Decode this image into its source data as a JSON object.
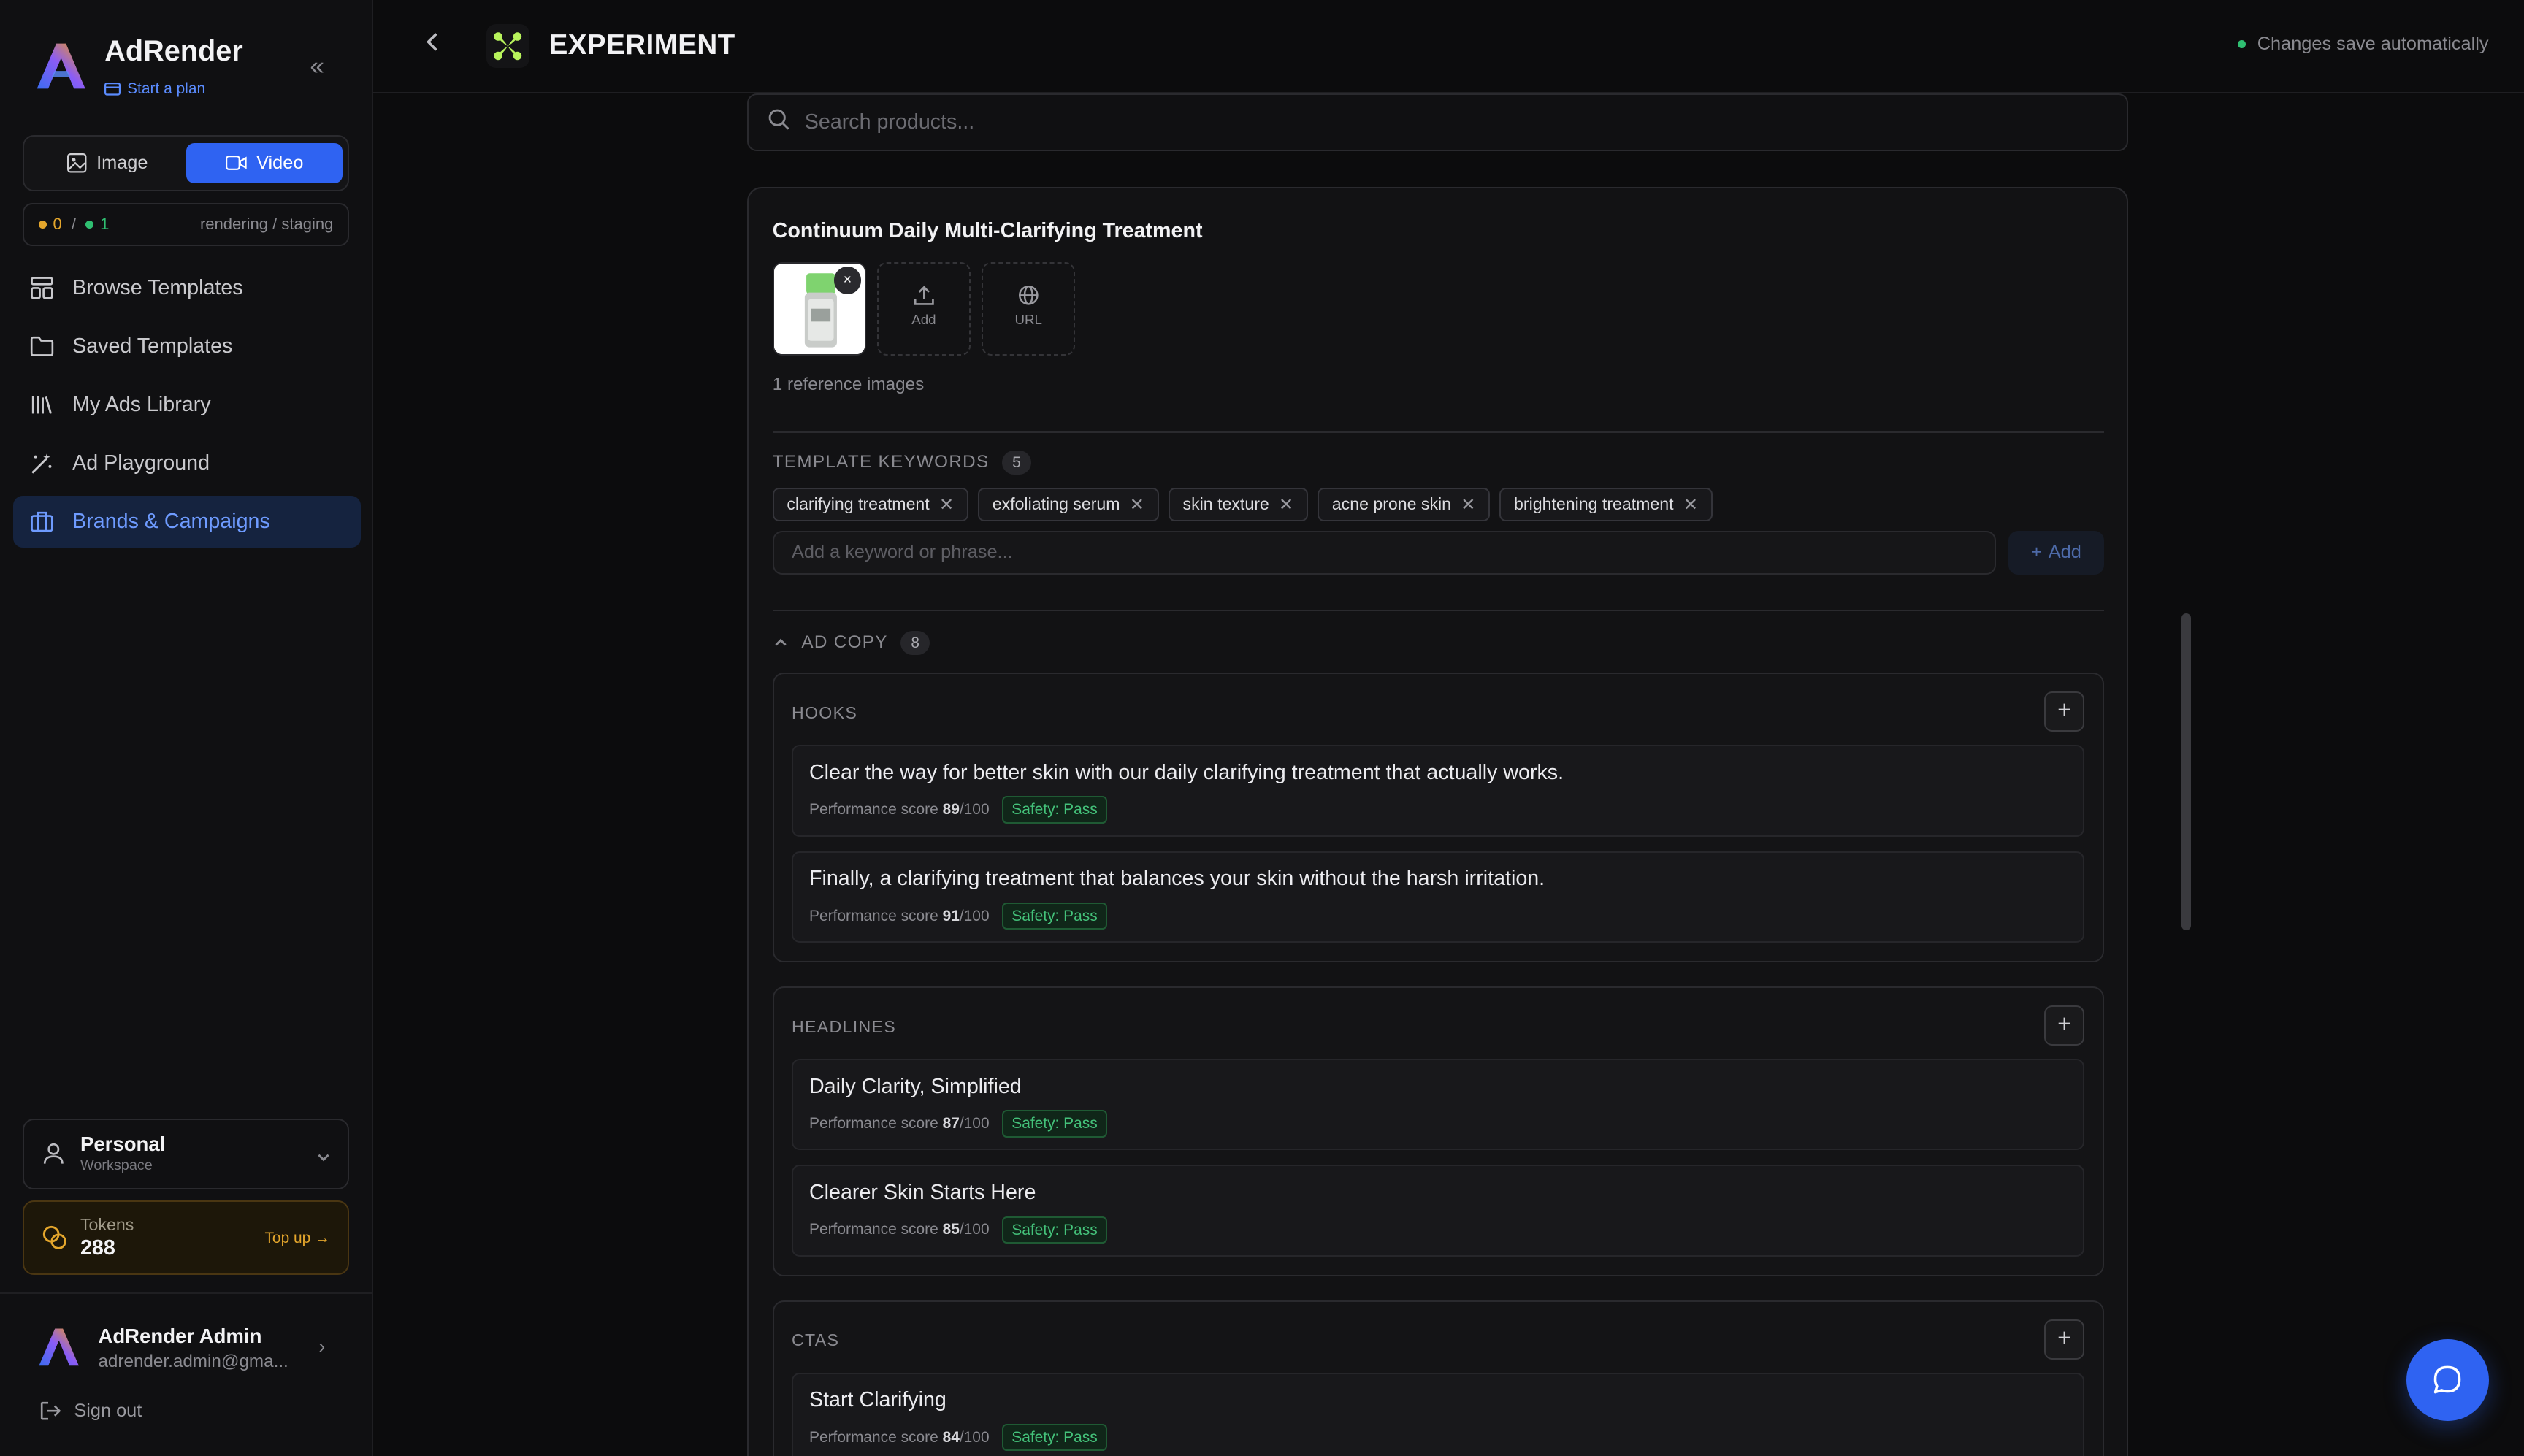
{
  "brand": {
    "name": "AdRender",
    "plan_link": "Start a plan"
  },
  "mode_switch": {
    "image_label": "Image",
    "video_label": "Video",
    "selected": "Video"
  },
  "status": {
    "rendering_count": "0",
    "separator": "/",
    "staging_count": "1",
    "label": "rendering / staging",
    "rendering_color": "#e4a62c",
    "staging_color": "#2fbf71"
  },
  "nav": {
    "items": [
      {
        "label": "Browse Templates",
        "icon": "layout-icon"
      },
      {
        "label": "Saved Templates",
        "icon": "folder-icon"
      },
      {
        "label": "My Ads Library",
        "icon": "library-icon"
      },
      {
        "label": "Ad Playground",
        "icon": "wand-icon"
      },
      {
        "label": "Brands & Campaigns",
        "icon": "briefcase-icon"
      }
    ],
    "active": "Brands & Campaigns"
  },
  "workspace": {
    "name": "Personal",
    "type": "Workspace"
  },
  "tokens": {
    "label": "Tokens",
    "value": "288",
    "top_up": "Top up →"
  },
  "user": {
    "name": "AdRender Admin",
    "email": "adrender.admin@gma...",
    "sign_out": "Sign out"
  },
  "header": {
    "title": "EXPERIMENT",
    "autosave": "Changes save automatically"
  },
  "search": {
    "placeholder": "Search products..."
  },
  "product": {
    "name": "Continuum Daily Multi-Clarifying Treatment",
    "add_label": "Add",
    "url_label": "URL",
    "ref_count": "1 reference images",
    "remove_label": "×"
  },
  "keywords": {
    "label": "TEMPLATE KEYWORDS",
    "count": "5",
    "items": [
      "clarifying treatment",
      "exfoliating serum",
      "skin texture",
      "acne prone skin",
      "brightening treatment"
    ],
    "input_placeholder": "Add a keyword or phrase...",
    "add_label": "Add"
  },
  "ad_copy": {
    "label": "AD COPY",
    "count": "8",
    "score_prefix": "Performance score",
    "score_suffix": "/100",
    "groups": [
      {
        "title": "HOOKS",
        "items": [
          {
            "text": "Clear the way for better skin with our daily clarifying treatment that actually works.",
            "score": "89",
            "safety": "Safety: Pass"
          },
          {
            "text": "Finally, a clarifying treatment that balances your skin without the harsh irritation.",
            "score": "91",
            "safety": "Safety: Pass"
          }
        ]
      },
      {
        "title": "HEADLINES",
        "items": [
          {
            "text": "Daily Clarity, Simplified",
            "score": "87",
            "safety": "Safety: Pass"
          },
          {
            "text": "Clearer Skin Starts Here",
            "score": "85",
            "safety": "Safety: Pass"
          }
        ]
      },
      {
        "title": "CTAS",
        "items": [
          {
            "text": "Start Clarifying",
            "score": "84",
            "safety": "Safety: Pass"
          }
        ]
      }
    ]
  },
  "colors": {
    "accent": "#2f63f2",
    "success": "#44c27a",
    "warning": "#e4a62c"
  }
}
